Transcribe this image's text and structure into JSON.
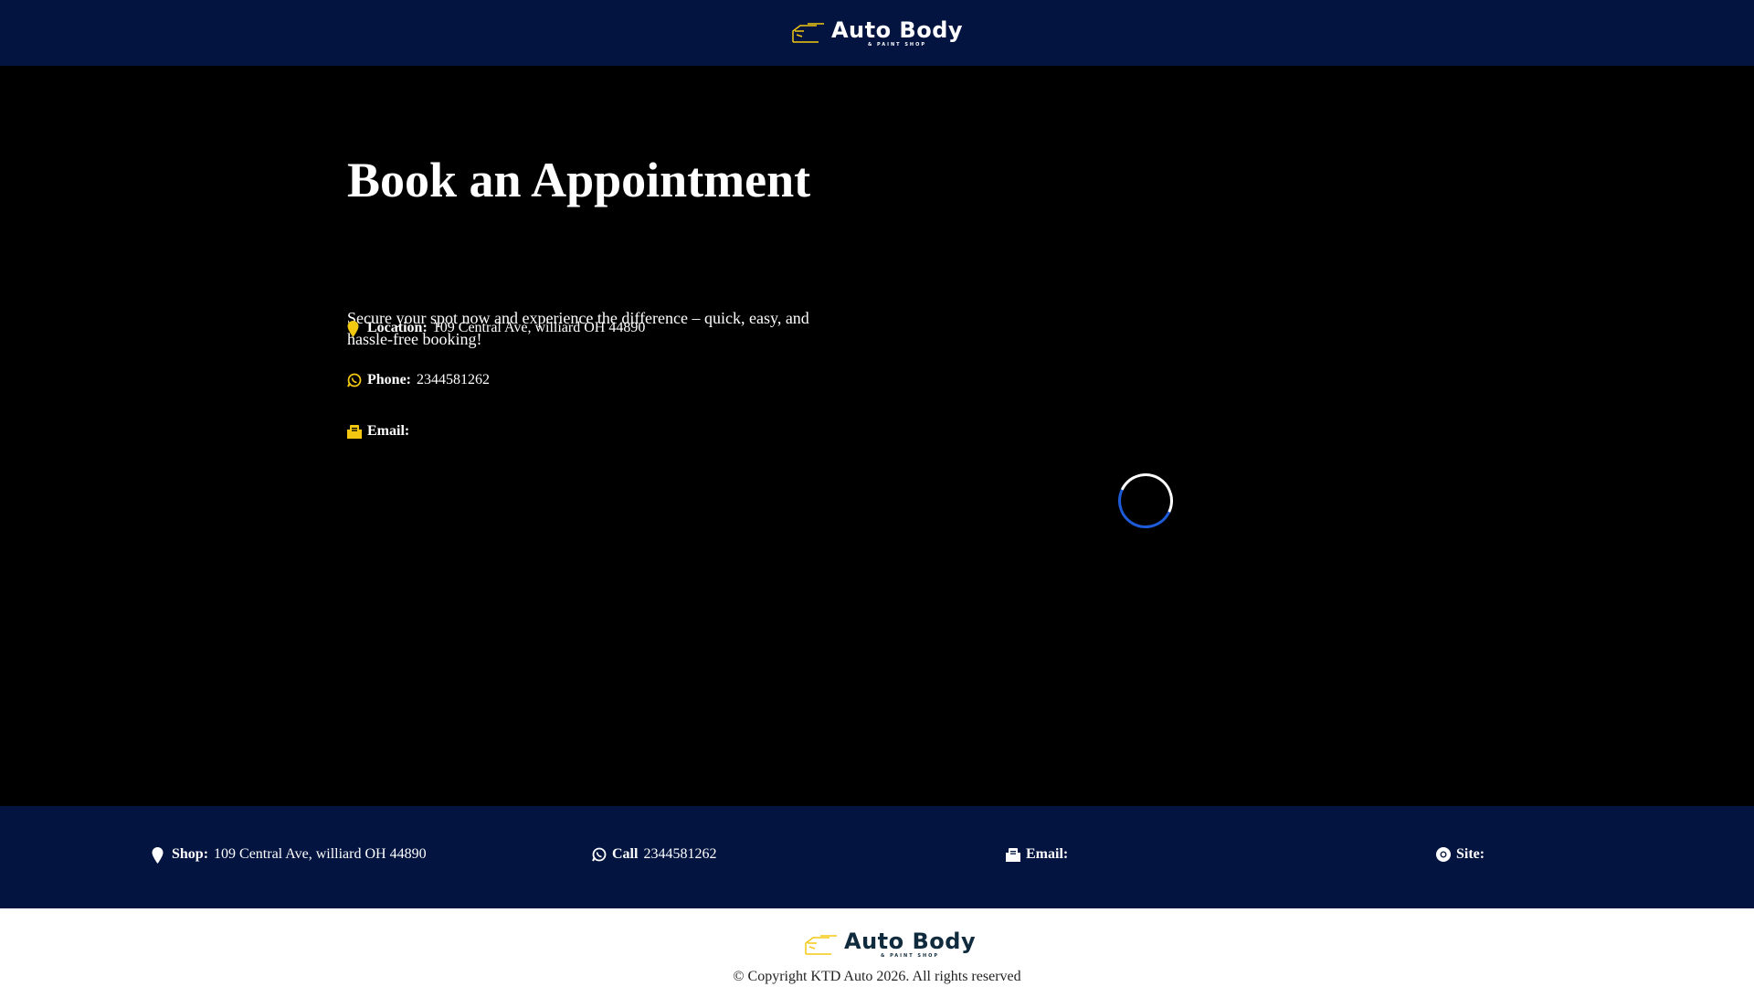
{
  "header": {
    "logo_main": "Auto Body",
    "logo_sub": "& PAINT SHOP"
  },
  "hero": {
    "title": "Book an Appointment",
    "intro": "Secure your spot now and experience the difference – quick, easy, and hassle-free booking!",
    "location_label": "Location:",
    "location_value": "109 Central Ave, williard OH 44890",
    "phone_label": "Phone:",
    "phone_value": "2344581262",
    "email_label": "Email:"
  },
  "footer_bar": {
    "shop_label": "Shop:",
    "shop_value": "109 Central Ave, williard OH 44890",
    "call_label": "Call",
    "call_value": "2344581262",
    "email_label": "Email:",
    "site_label": "Site:"
  },
  "footer": {
    "logo_main": "Auto Body",
    "logo_sub": "& PAINT SHOP",
    "copyright": "© Copyright KTD Auto 2026. All rights reserved"
  },
  "colors": {
    "navy": "#02143f",
    "accent": "#f2c811",
    "spinner": "#1e5bd8"
  }
}
